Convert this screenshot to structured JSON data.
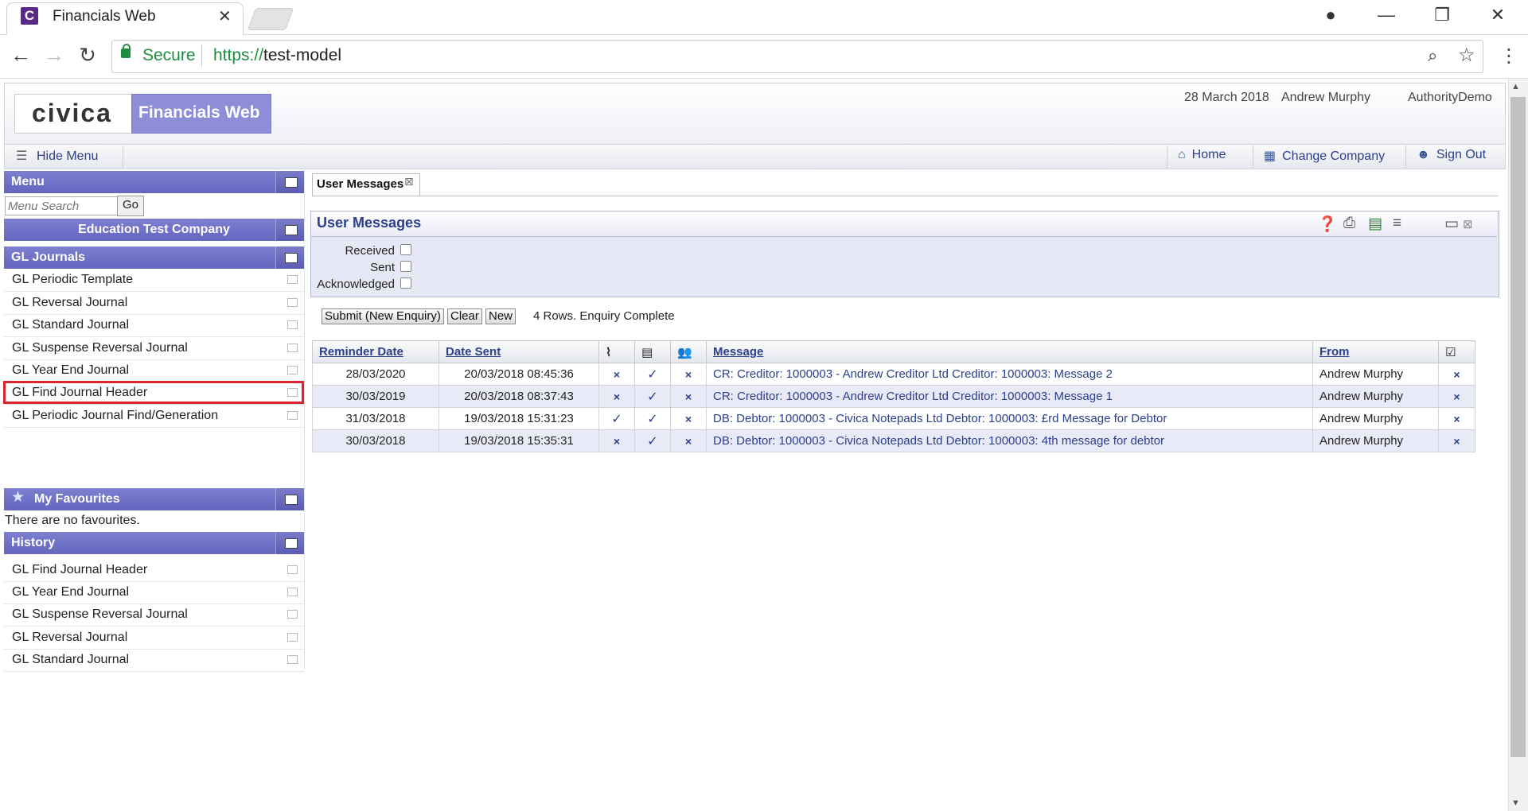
{
  "browser": {
    "tab_title": "Financials Web",
    "tab_favicon_letter": "C",
    "secure_label": "Secure",
    "url_protocol": "https://",
    "url_host": "test-model"
  },
  "header": {
    "logo": "civica",
    "product": "Financials Web",
    "date": "28 March 2018",
    "user": "Andrew Murphy",
    "authority": "AuthorityDemo"
  },
  "toolbar": {
    "hide_menu": "Hide Menu",
    "home": "Home",
    "change_company": "Change Company",
    "sign_out": "Sign Out"
  },
  "menu": {
    "title": "Menu",
    "search_placeholder": "Menu Search",
    "go_label": "Go",
    "company": "Education Test Company",
    "section": "GL Journals",
    "items": [
      "GL Periodic Template",
      "GL Reversal Journal",
      "GL Standard Journal",
      "GL Suspense Reversal Journal",
      "GL Year End Journal",
      "GL Find Journal Header",
      "GL Periodic Journal Find/Generation"
    ]
  },
  "favourites": {
    "title": "My Favourites",
    "empty_text": "There are no favourites."
  },
  "history": {
    "title": "History",
    "items": [
      "GL Find Journal Header",
      "GL Year End Journal",
      "GL Suspense Reversal Journal",
      "GL Reversal Journal",
      "GL Standard Journal"
    ]
  },
  "content": {
    "tab_label": "User Messages",
    "panel_title": "User Messages",
    "filters": [
      "Received",
      "Sent",
      "Acknowledged"
    ],
    "buttons": {
      "submit": "Submit (New Enquiry)",
      "clear": "Clear",
      "new": "New"
    },
    "status": "4 Rows. Enquiry Complete",
    "table": {
      "columns": [
        "Reminder Date",
        "Date Sent",
        "",
        "",
        "",
        "Message",
        "From",
        ""
      ],
      "rows": [
        {
          "reminder": "28/03/2020",
          "sent": "20/03/2018 08:45:36",
          "attach": "×",
          "note": "✓",
          "group": "×",
          "message": "CR: Creditor: 1000003 - Andrew Creditor Ltd Creditor: 1000003: Message 2",
          "from": "Andrew Murphy",
          "ack": "×"
        },
        {
          "reminder": "30/03/2019",
          "sent": "20/03/2018 08:37:43",
          "attach": "×",
          "note": "✓",
          "group": "×",
          "message": "CR: Creditor: 1000003 - Andrew Creditor Ltd Creditor: 1000003: Message 1",
          "from": "Andrew Murphy",
          "ack": "×"
        },
        {
          "reminder": "31/03/2018",
          "sent": "19/03/2018 15:31:23",
          "attach": "✓",
          "note": "✓",
          "group": "×",
          "message": "DB: Debtor: 1000003 - Civica Notepads Ltd Debtor: 1000003: £rd Message for Debtor",
          "from": "Andrew Murphy",
          "ack": "×"
        },
        {
          "reminder": "30/03/2018",
          "sent": "19/03/2018 15:35:31",
          "attach": "×",
          "note": "✓",
          "group": "×",
          "message": "DB: Debtor: 1000003 - Civica Notepads Ltd Debtor: 1000003: 4th message for debtor",
          "from": "Andrew Murphy",
          "ack": "×"
        }
      ]
    }
  },
  "colors": {
    "accent": "#6466c0",
    "link": "#2b3f8c",
    "highlight": "#d9252d",
    "secure": "#1e8e3e"
  }
}
